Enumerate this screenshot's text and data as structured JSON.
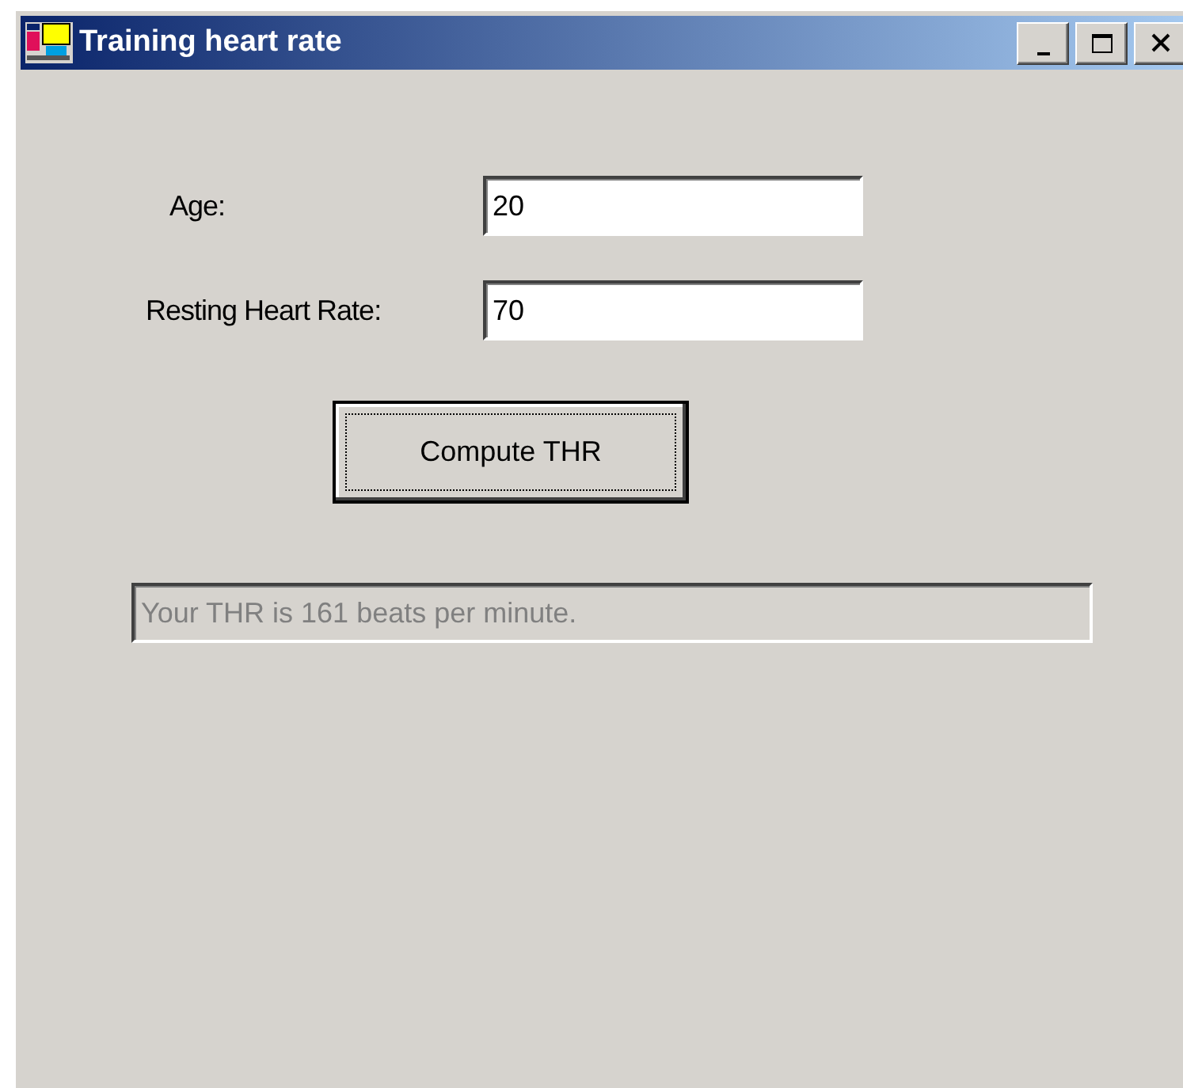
{
  "window": {
    "title": "Training heart rate",
    "controls": [
      {
        "kind": "minimize"
      },
      {
        "kind": "maximize"
      },
      {
        "kind": "close"
      }
    ]
  },
  "fields": [
    {
      "label": "Age:",
      "value": "20",
      "disabled": false
    },
    {
      "label": "Resting Heart Rate:",
      "value": "70",
      "disabled": false
    }
  ],
  "button": {
    "label": "Compute THR",
    "focused": true
  },
  "result": {
    "value": "Your THR is 161 beats per minute.",
    "disabled": true
  }
}
